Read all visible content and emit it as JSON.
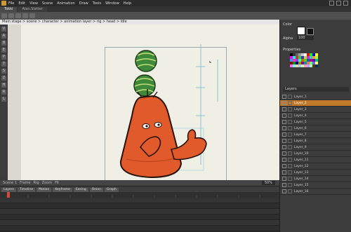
{
  "menu": {
    "items": [
      "File",
      "Edit",
      "View",
      "Scene",
      "Animation",
      "Draw",
      "Tools",
      "Window",
      "Help"
    ]
  },
  "tabs": [
    {
      "label": "Tokki",
      "active": true
    },
    {
      "label": "Alan.Slatter",
      "active": false
    }
  ],
  "path": {
    "text": "Main stage > scene > character > animation layer > rig > head > Idle"
  },
  "tools": [
    "V",
    "A",
    "B",
    "E",
    "P",
    "T",
    "S",
    "Z",
    "H",
    "R",
    "L"
  ],
  "stage_status": {
    "items": [
      "Scene 1",
      "Frame",
      "Rig",
      "Zoom",
      "Fit"
    ],
    "zoom": "50%"
  },
  "timeline": {
    "buttons": [
      "Layers",
      "Timeline",
      "Motion",
      "Keyframe",
      "Easing",
      "Onion",
      "Graph"
    ],
    "frame": "1"
  },
  "right_panel": {
    "color_label": "Color",
    "alpha_label": "Alpha",
    "alpha_value": "100",
    "props_label": "Properties",
    "layers_label": "Layers",
    "layer_names": [
      "Layer_1",
      "Layer_2",
      "Layer_3",
      "Layer_4",
      "Layer_5",
      "Layer_6",
      "Layer_7",
      "Layer_8",
      "Layer_9",
      "Layer_10",
      "Layer_11",
      "Layer_12",
      "Layer_13",
      "Layer_14",
      "Layer_15",
      "Layer_16"
    ],
    "selected_layer_index": 1
  },
  "colors": {
    "accent": "#c17a2a",
    "carrot": "#e05a2c",
    "watermelon": "#3f8a3a",
    "stage": "#efefe5"
  }
}
